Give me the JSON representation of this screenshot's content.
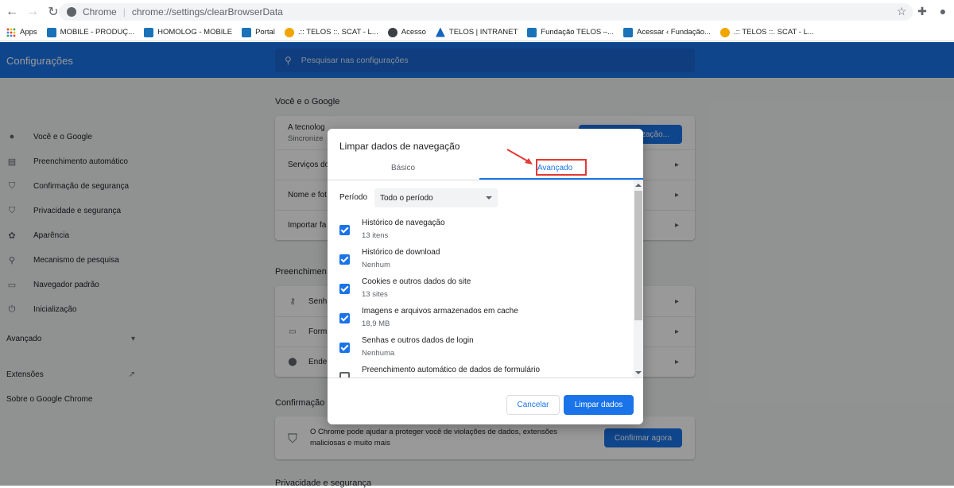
{
  "browser": {
    "origin": "Chrome",
    "url": "chrome://settings/clearBrowserData",
    "bookmarks": [
      {
        "label": "Apps",
        "icon": "apps-grid-icon"
      },
      {
        "label": "MOBILE - PRODUÇ...",
        "icon": "site-icon"
      },
      {
        "label": "HOMOLOG - MOBILE",
        "icon": "site-icon"
      },
      {
        "label": "Portal",
        "icon": "site-icon"
      },
      {
        "label": ".:: TELOS ::. SCAT - L...",
        "icon": "sun-icon"
      },
      {
        "label": "Acesso",
        "icon": "globe-icon"
      },
      {
        "label": "TELOS | INTRANET",
        "icon": "telos-icon"
      },
      {
        "label": "Fundação TELOS –...",
        "icon": "site-icon"
      },
      {
        "label": "Acessar ‹ Fundação...",
        "icon": "site-icon"
      },
      {
        "label": ".:: TELOS ::. SCAT - L...",
        "icon": "sun-icon"
      }
    ]
  },
  "settings": {
    "title": "Configurações",
    "search_placeholder": "Pesquisar nas configurações",
    "sidebar": [
      {
        "label": "Você e o Google",
        "icon": "person-icon"
      },
      {
        "label": "Preenchimento automático",
        "icon": "clipboard-icon"
      },
      {
        "label": "Confirmação de segurança",
        "icon": "shield-icon"
      },
      {
        "label": "Privacidade e segurança",
        "icon": "shield-lock-icon"
      },
      {
        "label": "Aparência",
        "icon": "palette-icon"
      },
      {
        "label": "Mecanismo de pesquisa",
        "icon": "search-icon"
      },
      {
        "label": "Navegador padrão",
        "icon": "browser-icon"
      },
      {
        "label": "Inicialização",
        "icon": "power-icon"
      }
    ],
    "advanced": "Avançado",
    "extensions": "Extensões",
    "about": "Sobre o Google Chrome",
    "sections": {
      "you_google": "Você e o Google",
      "sync_row_1": "A tecnolog",
      "sync_row_1_sub": "Sincronize",
      "sync_button": "ização...",
      "row_services": "Serviços do",
      "row_name": "Nome e fot",
      "row_import": "Importar fa",
      "autofill": "Preenchimen",
      "row_passwords": "Senh",
      "row_payment": "Form",
      "row_address": "Ende",
      "safety": "Confirmação",
      "safety_text_1": "O Chrome pode ajudar a proteger você de violações de dados, extensões",
      "safety_text_2": "maliciosas e muito mais",
      "safety_button": "Confirmar agora",
      "privacy": "Privacidade e segurança"
    }
  },
  "dialog": {
    "title": "Limpar dados de navegação",
    "tab_basic": "Básico",
    "tab_advanced": "Avançado",
    "period_label": "Período",
    "period_value": "Todo o período",
    "items": [
      {
        "title": "Histórico de navegação",
        "sub": "13 itens",
        "checked": true
      },
      {
        "title": "Histórico de download",
        "sub": "Nenhum",
        "checked": true
      },
      {
        "title": "Cookies e outros dados do site",
        "sub": "13 sites",
        "checked": true
      },
      {
        "title": "Imagens e arquivos armazenados em cache",
        "sub": "18,9 MB",
        "checked": true
      },
      {
        "title": "Senhas e outros dados de login",
        "sub": "Nenhuma",
        "checked": true
      },
      {
        "title": "Preenchimento automático de dados de formulário",
        "sub": "",
        "checked": false
      }
    ],
    "cancel": "Cancelar",
    "clear": "Limpar dados"
  },
  "annotation": {
    "color": "#e53935"
  },
  "colors": {
    "accent": "#1a73e8"
  }
}
